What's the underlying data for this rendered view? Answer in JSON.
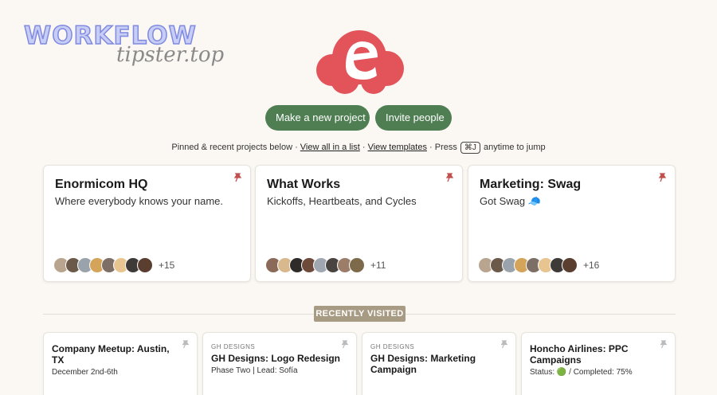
{
  "watermark": {
    "top": "WORKFLOW",
    "bottom": "tipster.top"
  },
  "actions": {
    "new_project": "Make a new project",
    "invite": "Invite people"
  },
  "info": {
    "prefix": "Pinned & recent projects below · ",
    "view_all": "View all in a list",
    "sep": " · ",
    "view_templates": "View templates",
    "press": " · Press ",
    "shortcut": "⌘J",
    "suffix": " anytime to jump"
  },
  "pinned": [
    {
      "title": "Enormicom HQ",
      "description": "Where everybody knows your name.",
      "more": "+15"
    },
    {
      "title": "What Works",
      "description": "Kickoffs, Heartbeats, and Cycles",
      "more": "+11"
    },
    {
      "title": "Marketing: Swag",
      "description": "Got Swag 🧢",
      "more": "+16"
    }
  ],
  "recently_visited_label": "RECENTLY VISITED",
  "recent": [
    {
      "caption": "",
      "title": "Company Meetup: Austin, TX",
      "subtitle": "December 2nd-6th"
    },
    {
      "caption": "GH DESIGNS",
      "title": "GH Designs: Logo Redesign",
      "subtitle": "Phase Two | Lead: Sofía"
    },
    {
      "caption": "GH DESIGNS",
      "title": "GH Designs: Marketing Campaign",
      "subtitle": ""
    },
    {
      "caption": "",
      "title": "Honcho Airlines: PPC Campaigns",
      "subtitle": "Status: 🟢 / Completed: 75%"
    }
  ],
  "colors": {
    "accent": "#4e7e52",
    "logo": "#e2535a",
    "badge": "#a89b84",
    "pin": "#c0504d"
  }
}
